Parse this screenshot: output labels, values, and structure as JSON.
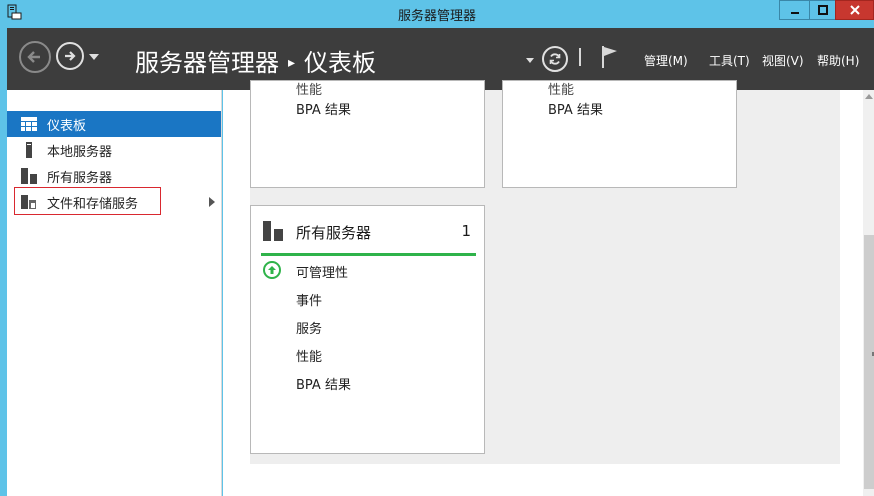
{
  "window": {
    "title": "服务器管理器",
    "app_icon": "server-manager-app-icon",
    "buttons": {
      "minimize": "minimize-icon",
      "maximize": "maximize-icon",
      "close": "close-icon"
    }
  },
  "toolbar": {
    "breadcrumb_root": "服务器管理器",
    "breadcrumb_sep": "▸",
    "breadcrumb_current": "仪表板",
    "menus": [
      "管理(M)",
      "工具(T)",
      "视图(V)",
      "帮助(H)"
    ],
    "sep": "|"
  },
  "sidebar": {
    "items": [
      {
        "label": "仪表板",
        "icon": "dashboard-icon",
        "active": true
      },
      {
        "label": "本地服务器",
        "icon": "local-server-icon"
      },
      {
        "label": "所有服务器",
        "icon": "all-servers-icon"
      },
      {
        "label": "文件和存储服务",
        "icon": "file-storage-icon",
        "outlined": true,
        "has_submenu": true
      }
    ]
  },
  "tiles": {
    "top_left": {
      "cut_row": "性能",
      "bpa": "BPA 结果"
    },
    "top_right": {
      "cut_row": "性能",
      "bpa": "BPA 结果"
    },
    "all_servers": {
      "title": "所有服务器",
      "count": "1",
      "rows": [
        "可管理性",
        "事件",
        "服务",
        "性能",
        "BPA 结果"
      ]
    }
  },
  "colors": {
    "titlebar": "#5ec3e8",
    "toolbar": "#3d3d3d",
    "selection": "#1a76c4",
    "status_green": "#2fb34a",
    "close_red": "#c7372f"
  }
}
